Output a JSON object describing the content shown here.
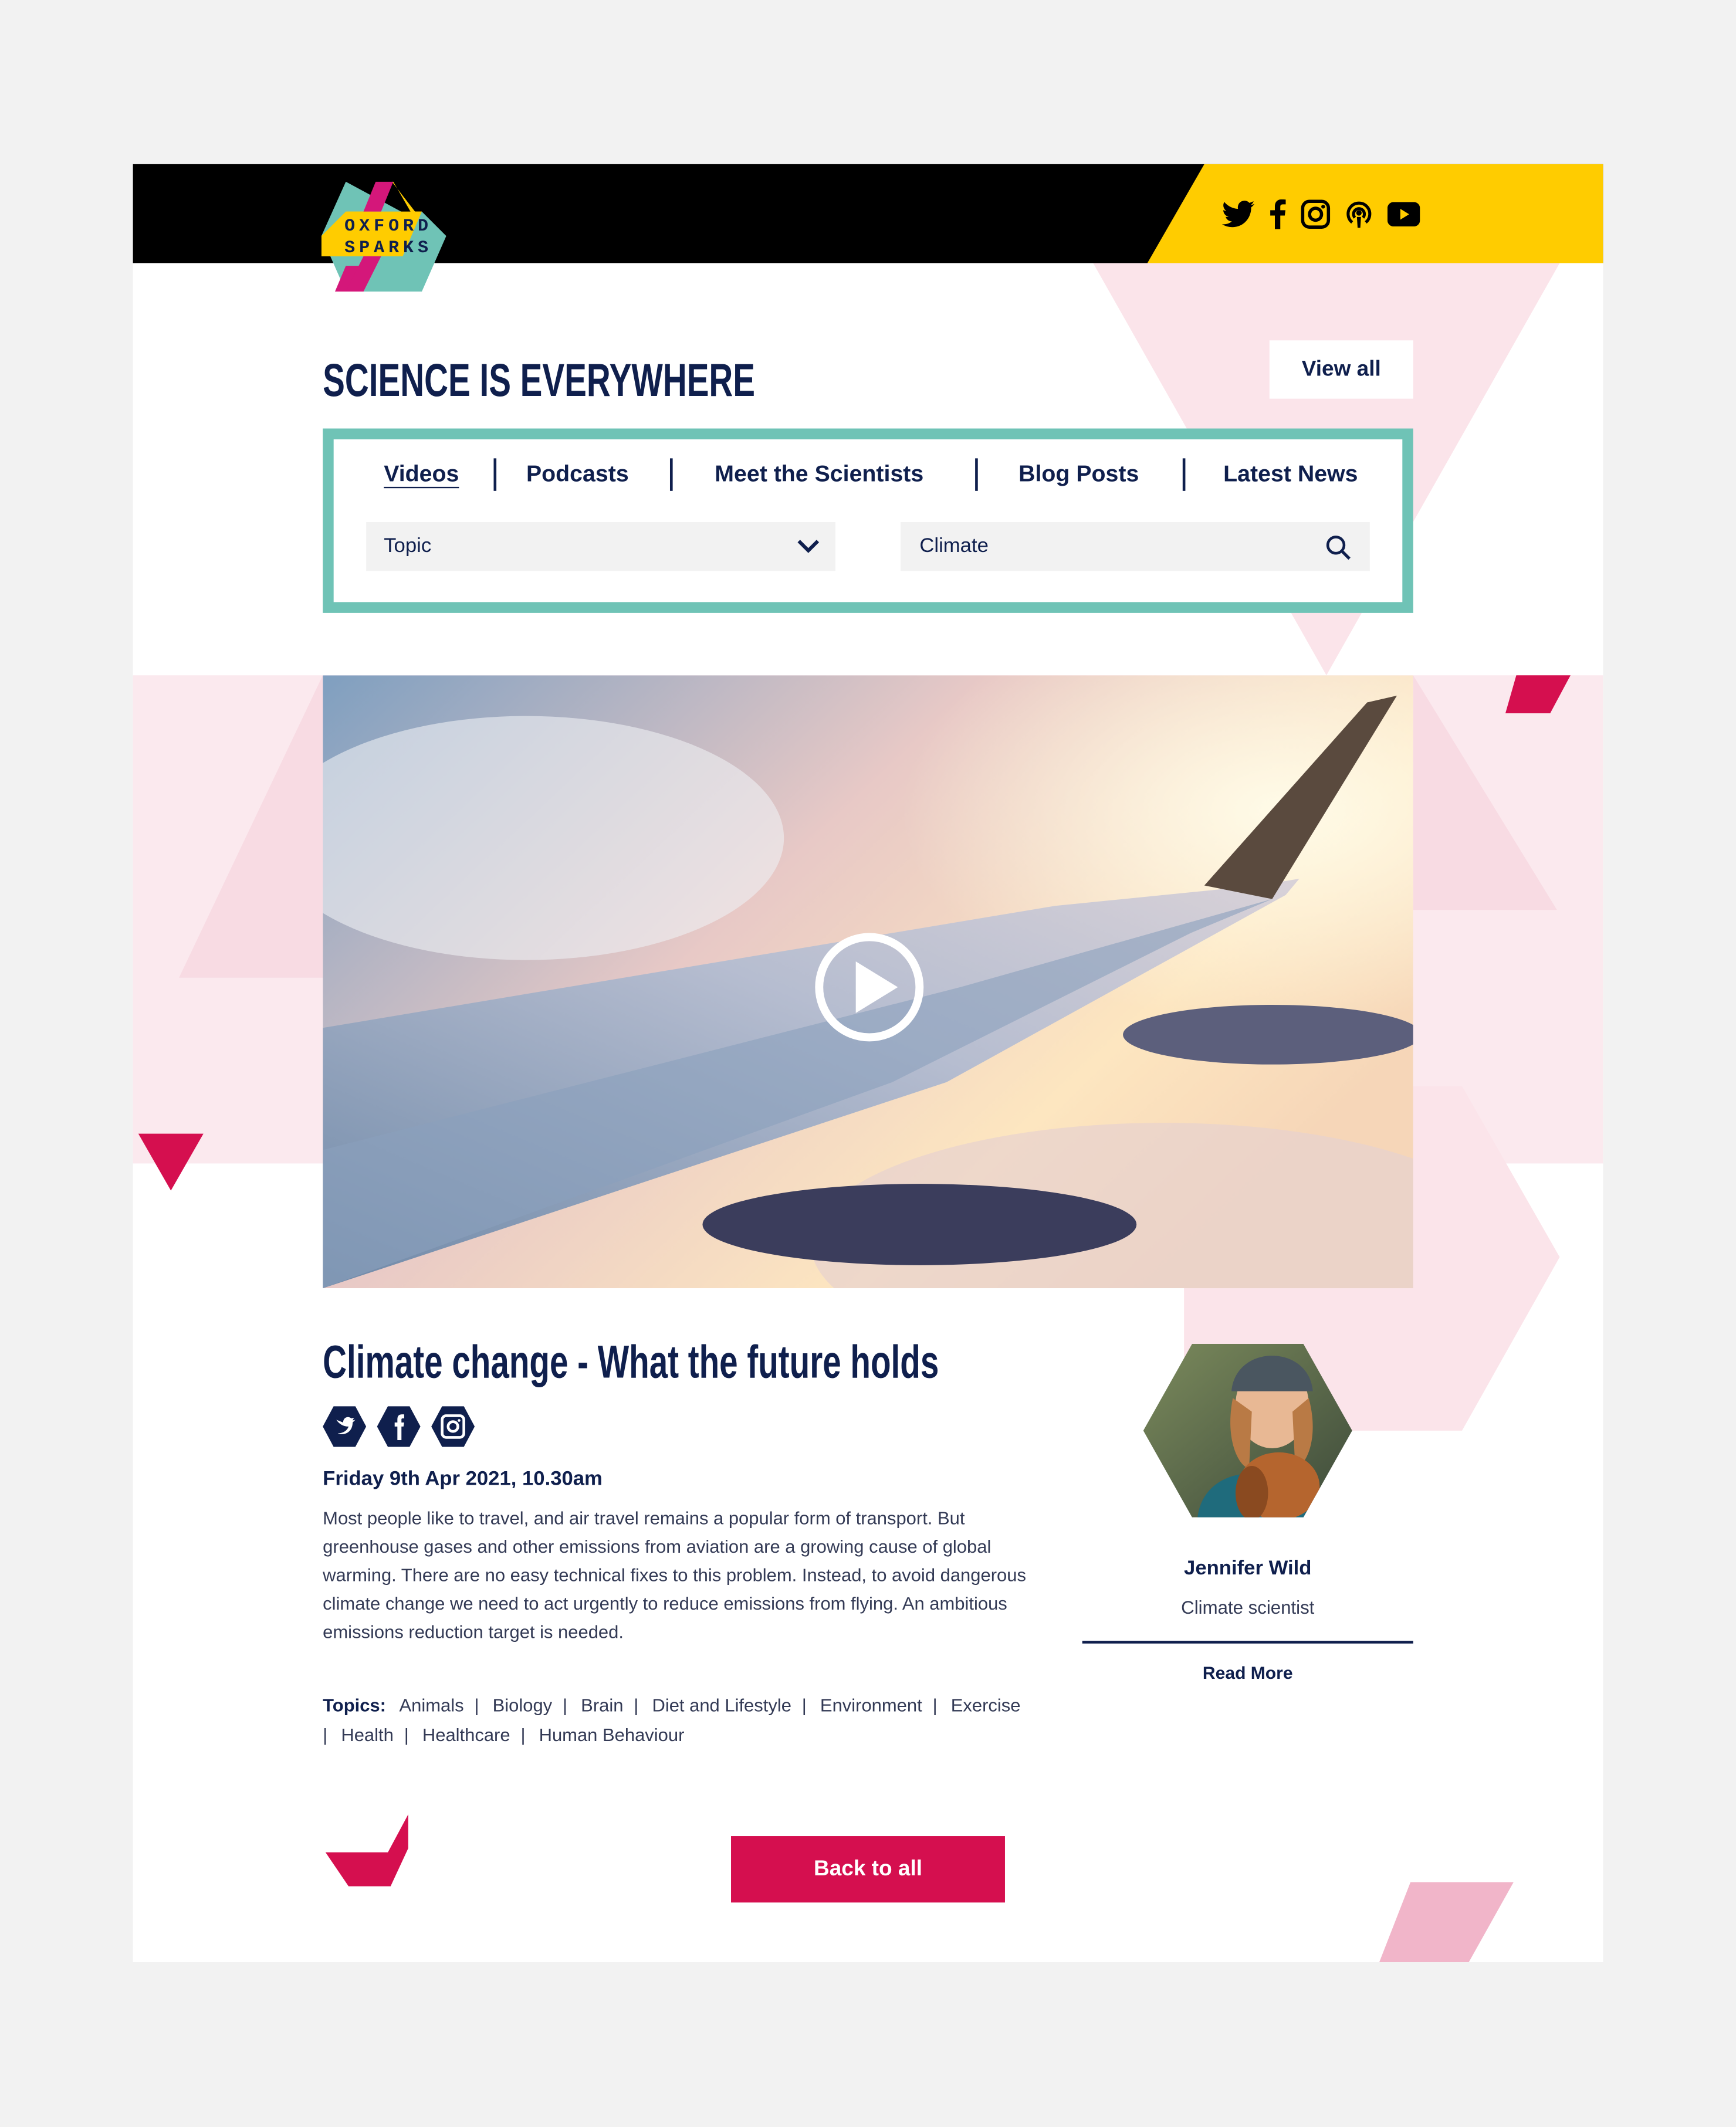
{
  "brand": {
    "logo_text_line1": "OXFORD",
    "logo_text_line2": "SPARKS"
  },
  "header": {
    "social_icons": [
      "twitter-icon",
      "facebook-icon",
      "instagram-icon",
      "podcast-icon",
      "youtube-icon"
    ]
  },
  "section": {
    "title": "SCIENCE IS EVERYWHERE",
    "view_all": "View all"
  },
  "tabs": [
    {
      "label": "Videos",
      "active": true
    },
    {
      "label": "Podcasts"
    },
    {
      "label": "Meet the Scientists"
    },
    {
      "label": "Blog Posts"
    },
    {
      "label": "Latest News"
    }
  ],
  "filters": {
    "topic": "Topic",
    "search_value": "Climate"
  },
  "article": {
    "title": "Climate change - What the future holds",
    "share_icons": [
      "twitter-icon",
      "facebook-icon",
      "instagram-icon"
    ],
    "date": "Friday 9th Apr 2021, 10.30am",
    "body": "Most people like to travel, and air travel remains a popular form of transport. But greenhouse gases and other emissions from aviation are a growing cause of global warming. There are no easy technical fixes to this problem. Instead, to avoid dangerous climate change we need to act urgently to reduce emissions from flying. An ambitious emissions reduction target is needed.",
    "topics_label": "Topics:",
    "topics": [
      "Animals",
      "Biology",
      "Brain",
      "Diet and Lifestyle",
      "Environment",
      "Exercise",
      "Health",
      "Healthcare",
      "Human Behaviour"
    ]
  },
  "author": {
    "name": "Jennifer Wild",
    "role": "Climate scientist",
    "read_more": "Read More"
  },
  "back_button": "Back to all",
  "colors": {
    "navy": "#0f1f4d",
    "yellow": "#ffcc00",
    "teal": "#6fc3b6",
    "crimson": "#d50f4f",
    "pink": "#fbe9ee"
  }
}
